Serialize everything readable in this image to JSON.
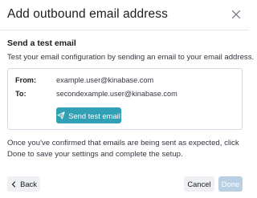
{
  "modal": {
    "title": "Add outbound email address",
    "close_icon": "close-icon"
  },
  "test_section": {
    "title": "Send a test email",
    "description": "Test your email configuration by sending an email to your email address.",
    "from_label": "From:",
    "from_value": "example.user@kinabase.com",
    "to_label": "To:",
    "to_value": "secondexample.user@kinabase.com",
    "send_button_label": "Send test email",
    "send_button_icon": "paper-plane-icon"
  },
  "note": "Once you've confirmed that emails are being sent as expected, click Done to save your settings and complete the setup.",
  "footer": {
    "back_label": "Back",
    "back_icon": "chevron-left-icon",
    "cancel_label": "Cancel",
    "done_label": "Done"
  },
  "colors": {
    "primary": "#31a0b5",
    "disabled_primary": "#b9cfe3",
    "secondary_bg": "#eef0f4"
  }
}
